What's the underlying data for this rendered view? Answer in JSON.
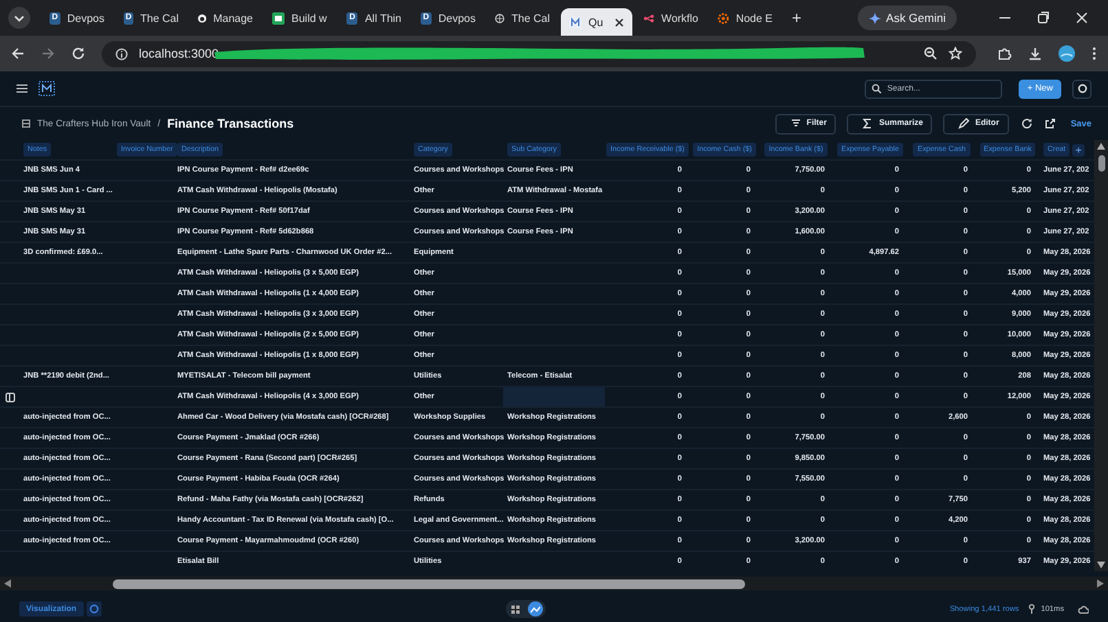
{
  "browser": {
    "tabs": [
      {
        "title": "Devpos",
        "kind": "letter",
        "badge": "D",
        "selected": false
      },
      {
        "title": "The Cal",
        "kind": "letter",
        "badge": "D",
        "selected": false
      },
      {
        "title": "Manage",
        "kind": "github",
        "selected": false
      },
      {
        "title": "Build w",
        "kind": "sheet",
        "selected": false
      },
      {
        "title": "All Thin",
        "kind": "letter",
        "badge": "D",
        "selected": false
      },
      {
        "title": "Devpos",
        "kind": "letter",
        "badge": "D",
        "selected": false
      },
      {
        "title": "The Cal",
        "kind": "globe",
        "selected": false
      },
      {
        "title": "Qu",
        "kind": "app",
        "selected": true
      },
      {
        "title": "Workflo",
        "kind": "flow",
        "selected": false
      },
      {
        "title": "Node E",
        "kind": "gear",
        "selected": false
      }
    ],
    "new_tab": "+",
    "gemini": "Ask Gemini",
    "url": "localhost:3000"
  },
  "app": {
    "search": {
      "placeholder": "Search..."
    },
    "new_button": "+ New",
    "breadcrumb": {
      "parent": "The Crafters Hub Iron Vault",
      "separator": "/",
      "title": "Finance Transactions"
    },
    "toolbar": [
      "Filter",
      "Summarize",
      "Editor"
    ],
    "save": "Save"
  },
  "table": {
    "columns": [
      {
        "label": "Notes",
        "kind": "text"
      },
      {
        "label": "Invoice Number",
        "kind": "text"
      },
      {
        "label": "Description",
        "kind": "text"
      },
      {
        "label": "Category",
        "kind": "text"
      },
      {
        "label": "Sub Category",
        "kind": "text"
      },
      {
        "label": "Income Receivable ($)",
        "kind": "number"
      },
      {
        "label": "Income Cash ($)",
        "kind": "number"
      },
      {
        "label": "Income Bank ($)",
        "kind": "number"
      },
      {
        "label": "Expense Payable",
        "kind": "number"
      },
      {
        "label": "Expense Cash",
        "kind": "number"
      },
      {
        "label": "Expense Bank",
        "kind": "number"
      },
      {
        "label": "Creat",
        "kind": "date"
      }
    ],
    "add_column": "+",
    "rows": [
      {
        "focused": false,
        "cells": [
          "JNB SMS Jun 4",
          "",
          "IPN Course Payment - Ref# d2ee69c",
          "Courses and Workshops",
          "Course Fees - IPN",
          "0",
          "0",
          "7,750.00",
          "0",
          "0",
          "0",
          "June 27, 202"
        ]
      },
      {
        "focused": false,
        "cells": [
          "JNB SMS Jun 1 - Card ...",
          "",
          "ATM Cash Withdrawal - Heliopolis (Mostafa)",
          "Other",
          "ATM Withdrawal - Mostafa",
          "0",
          "0",
          "0",
          "0",
          "0",
          "5,200",
          "June 27, 202"
        ]
      },
      {
        "focused": false,
        "cells": [
          "JNB SMS May 31",
          "",
          "IPN Course Payment - Ref# 50f17daf",
          "Courses and Workshops",
          "Course Fees - IPN",
          "0",
          "0",
          "3,200.00",
          "0",
          "0",
          "0",
          "June 27, 202"
        ]
      },
      {
        "focused": false,
        "cells": [
          "JNB SMS May 31",
          "",
          "IPN Course Payment - Ref# 5d62b868",
          "Courses and Workshops",
          "Course Fees - IPN",
          "0",
          "0",
          "1,600.00",
          "0",
          "0",
          "0",
          "June 27, 202"
        ]
      },
      {
        "focused": false,
        "cells": [
          "3D confirmed: £69.0...",
          "",
          "Equipment - Lathe Spare Parts - Charnwood UK Order #2...",
          "Equipment",
          "",
          "0",
          "0",
          "0",
          "4,897.62",
          "0",
          "0",
          "May 28, 2026"
        ]
      },
      {
        "focused": false,
        "cells": [
          "",
          "",
          "ATM Cash Withdrawal - Heliopolis (3 x 5,000 EGP)",
          "Other",
          "",
          "0",
          "0",
          "0",
          "0",
          "0",
          "15,000",
          "May 29, 2026"
        ]
      },
      {
        "focused": false,
        "cells": [
          "",
          "",
          "ATM Cash Withdrawal - Heliopolis (1 x 4,000 EGP)",
          "Other",
          "",
          "0",
          "0",
          "0",
          "0",
          "0",
          "4,000",
          "May 29, 2026"
        ]
      },
      {
        "focused": false,
        "cells": [
          "",
          "",
          "ATM Cash Withdrawal - Heliopolis (3 x 3,000 EGP)",
          "Other",
          "",
          "0",
          "0",
          "0",
          "0",
          "0",
          "9,000",
          "May 29, 2026"
        ]
      },
      {
        "focused": false,
        "cells": [
          "",
          "",
          "ATM Cash Withdrawal - Heliopolis (2 x 5,000 EGP)",
          "Other",
          "",
          "0",
          "0",
          "0",
          "0",
          "0",
          "10,000",
          "May 29, 2026"
        ]
      },
      {
        "focused": false,
        "cells": [
          "",
          "",
          "ATM Cash Withdrawal - Heliopolis (1 x 8,000 EGP)",
          "Other",
          "",
          "0",
          "0",
          "0",
          "0",
          "0",
          "8,000",
          "May 29, 2026"
        ]
      },
      {
        "focused": false,
        "cells": [
          "JNB **2190 debit (2nd...",
          "",
          "MYETISALAT - Telecom bill payment",
          "Utilities",
          "Telecom - Etisalat",
          "0",
          "0",
          "0",
          "0",
          "0",
          "208",
          "May 28, 2026"
        ]
      },
      {
        "focused": true,
        "cells": [
          "",
          "",
          "ATM Cash Withdrawal - Heliopolis (4 x 3,000 EGP)",
          "Other",
          "",
          "0",
          "0",
          "0",
          "0",
          "0",
          "12,000",
          "May 29, 2026"
        ]
      },
      {
        "focused": false,
        "cells": [
          "auto-injected from OC...",
          "",
          "Ahmed Car - Wood Delivery (via Mostafa cash) [OCR#268]",
          "Workshop Supplies",
          "Workshop Registrations",
          "0",
          "0",
          "0",
          "0",
          "2,600",
          "0",
          "May 28, 2026"
        ]
      },
      {
        "focused": false,
        "cells": [
          "auto-injected from OC...",
          "",
          "Course Payment - Jmaklad (OCR #266)",
          "Courses and Workshops",
          "Workshop Registrations",
          "0",
          "0",
          "7,750.00",
          "0",
          "0",
          "0",
          "May 28, 2026"
        ]
      },
      {
        "focused": false,
        "cells": [
          "auto-injected from OC...",
          "",
          "Course Payment - Rana (Second part) [OCR#265]",
          "Courses and Workshops",
          "Workshop Registrations",
          "0",
          "0",
          "9,850.00",
          "0",
          "0",
          "0",
          "May 28, 2026"
        ]
      },
      {
        "focused": false,
        "cells": [
          "auto-injected from OC...",
          "",
          "Course Payment - Habiba Fouda (OCR #264)",
          "Courses and Workshops",
          "Workshop Registrations",
          "0",
          "0",
          "7,550.00",
          "0",
          "0",
          "0",
          "May 28, 2026"
        ]
      },
      {
        "focused": false,
        "cells": [
          "auto-injected from OC...",
          "",
          "Refund - Maha Fathy (via Mostafa cash) [OCR#262]",
          "Refunds",
          "Workshop Registrations",
          "0",
          "0",
          "0",
          "0",
          "7,750",
          "0",
          "May 28, 2026"
        ]
      },
      {
        "focused": false,
        "cells": [
          "auto-injected from OC...",
          "",
          "Handy Accountant - Tax ID Renewal (via Mostafa cash) [O...",
          "Legal and Government...",
          "Workshop Registrations",
          "0",
          "0",
          "0",
          "0",
          "4,200",
          "0",
          "May 28, 2026"
        ]
      },
      {
        "focused": false,
        "cells": [
          "auto-injected from OC...",
          "",
          "Course Payment - Mayarmahmoudmd (OCR #260)",
          "Courses and Workshops",
          "Workshop Registrations",
          "0",
          "0",
          "3,200.00",
          "0",
          "0",
          "0",
          "May 28, 2026"
        ]
      },
      {
        "focused": false,
        "cells": [
          "",
          "",
          "Etisalat Bill",
          "Utilities",
          "",
          "0",
          "0",
          "0",
          "0",
          "0",
          "937",
          "May 29, 2026"
        ]
      }
    ]
  },
  "footer": {
    "visualization": "Visualization",
    "views": [
      {
        "kind": "table",
        "selected": false
      },
      {
        "kind": "chart",
        "selected": true
      }
    ],
    "row_count": "Showing 1,441 rows",
    "timing": "101ms"
  }
}
